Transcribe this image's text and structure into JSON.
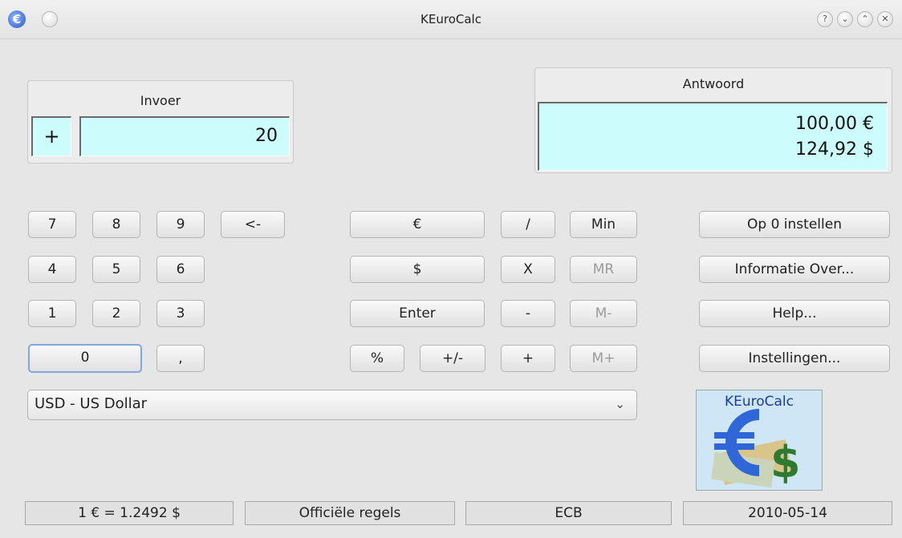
{
  "window": {
    "title": "KEuroCalc",
    "buttons": [
      "?",
      "⌄",
      "⌃",
      "✕"
    ]
  },
  "input_box": {
    "title": "Invoer",
    "sign": "+",
    "value": "20"
  },
  "answer_box": {
    "title": "Antwoord",
    "line1": "100,00 €",
    "line2": "124,92 $"
  },
  "keypad": {
    "k7": "7",
    "k8": "8",
    "k9": "9",
    "backspace": "<-",
    "k4": "4",
    "k5": "5",
    "k6": "6",
    "k1": "1",
    "k2": "2",
    "k3": "3",
    "k0": "0",
    "comma": ","
  },
  "ops": {
    "euro": "€",
    "dollar": "$",
    "enter": "Enter",
    "percent": "%",
    "plusminus": "+/-",
    "divide": "/",
    "multiply": "X",
    "minus": "-",
    "plus": "+",
    "min": "Min",
    "mr": "MR",
    "mminus": "M-",
    "mplus": "M+"
  },
  "actions": {
    "reset": "Op 0 instellen",
    "about": "Informatie Over...",
    "help": "Help...",
    "settings": "Instellingen..."
  },
  "currency_select": {
    "selected": "USD - US Dollar"
  },
  "logo": {
    "text": "KEuroCalc"
  },
  "statusbar": {
    "rate": "1 € = 1.2492 $",
    "rules": "Officiële regels",
    "source": "ECB",
    "date": "2010-05-14"
  },
  "colors": {
    "display_bg": "#ccfcfc",
    "window_bg": "#e6e6e6",
    "focus": "#7fa8dc"
  }
}
